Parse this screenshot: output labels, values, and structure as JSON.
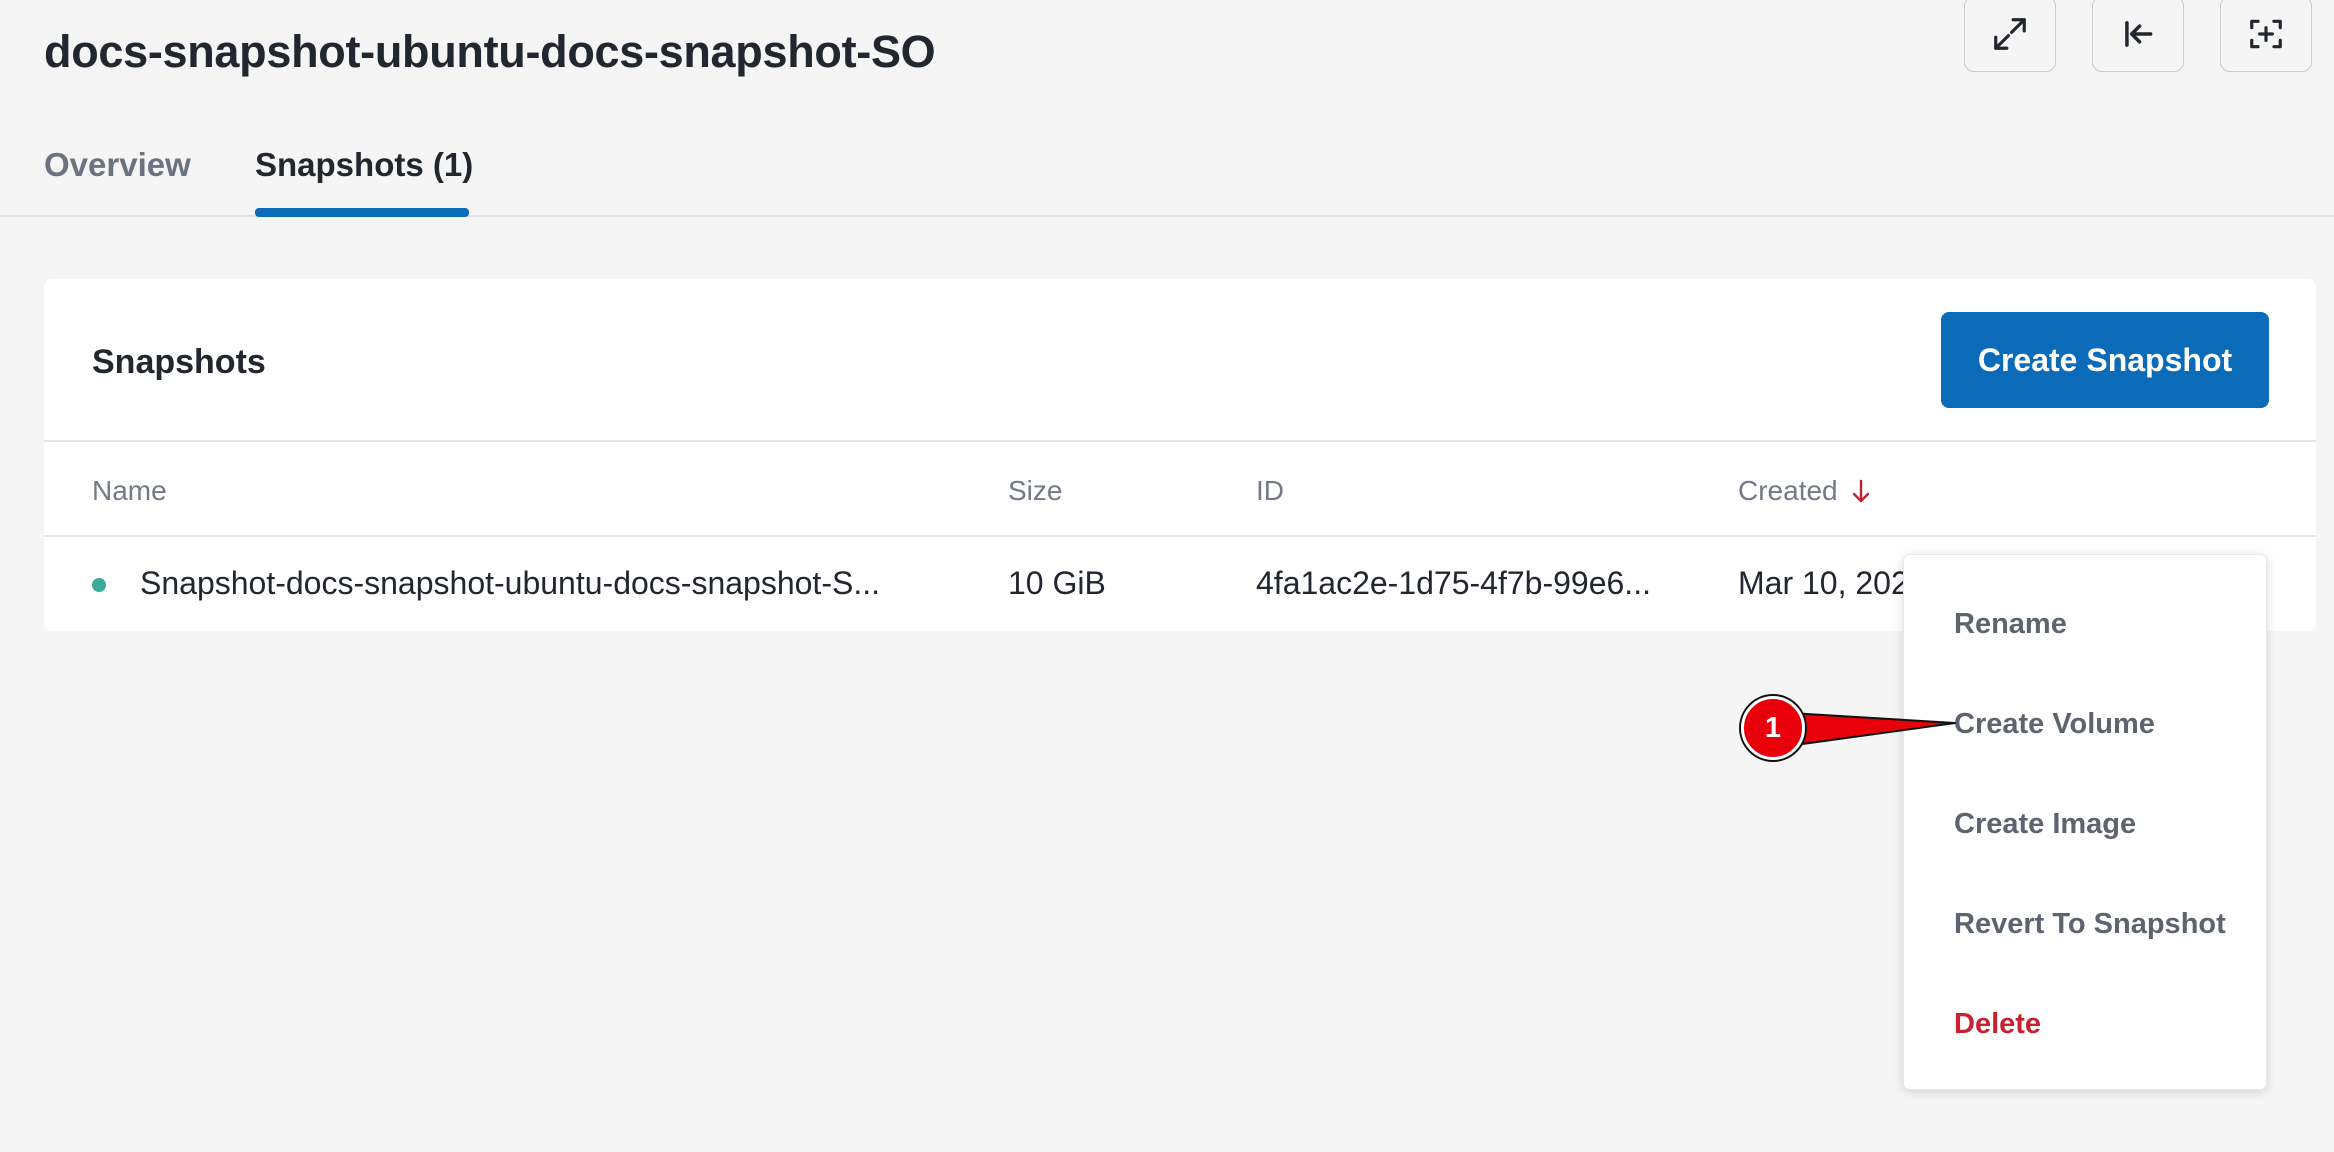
{
  "header": {
    "title": "docs-snapshot-ubuntu-docs-snapshot-SO",
    "actions": [
      {
        "icon": "expand-icon"
      },
      {
        "icon": "collapse-left-icon"
      },
      {
        "icon": "add-frame-icon"
      }
    ]
  },
  "tabs": [
    {
      "label": "Overview",
      "active": false
    },
    {
      "label": "Snapshots (1)",
      "active": true
    }
  ],
  "snapshots_card": {
    "title": "Snapshots",
    "create_button": "Create Snapshot",
    "columns": [
      "Name",
      "Size",
      "ID",
      "Created"
    ],
    "sort": {
      "column": "Created",
      "direction": "descending",
      "icon": "arrow-down-icon"
    },
    "rows": [
      {
        "status": "available",
        "name": "Snapshot-docs-snapshot-ubuntu-docs-snapshot-S...",
        "size": "10 GiB",
        "id": "4fa1ac2e-1d75-4f7b-99e6...",
        "created": "Mar 10, 202"
      }
    ]
  },
  "context_menu": {
    "items": [
      "Rename",
      "Create Volume",
      "Create Image",
      "Revert To Snapshot",
      "Delete"
    ]
  },
  "annotation": {
    "step": "1"
  },
  "colors": {
    "accent": "#0b6bb8",
    "status_ok": "#3aab98",
    "danger": "#c8202f",
    "annotation": "#e8000a"
  }
}
